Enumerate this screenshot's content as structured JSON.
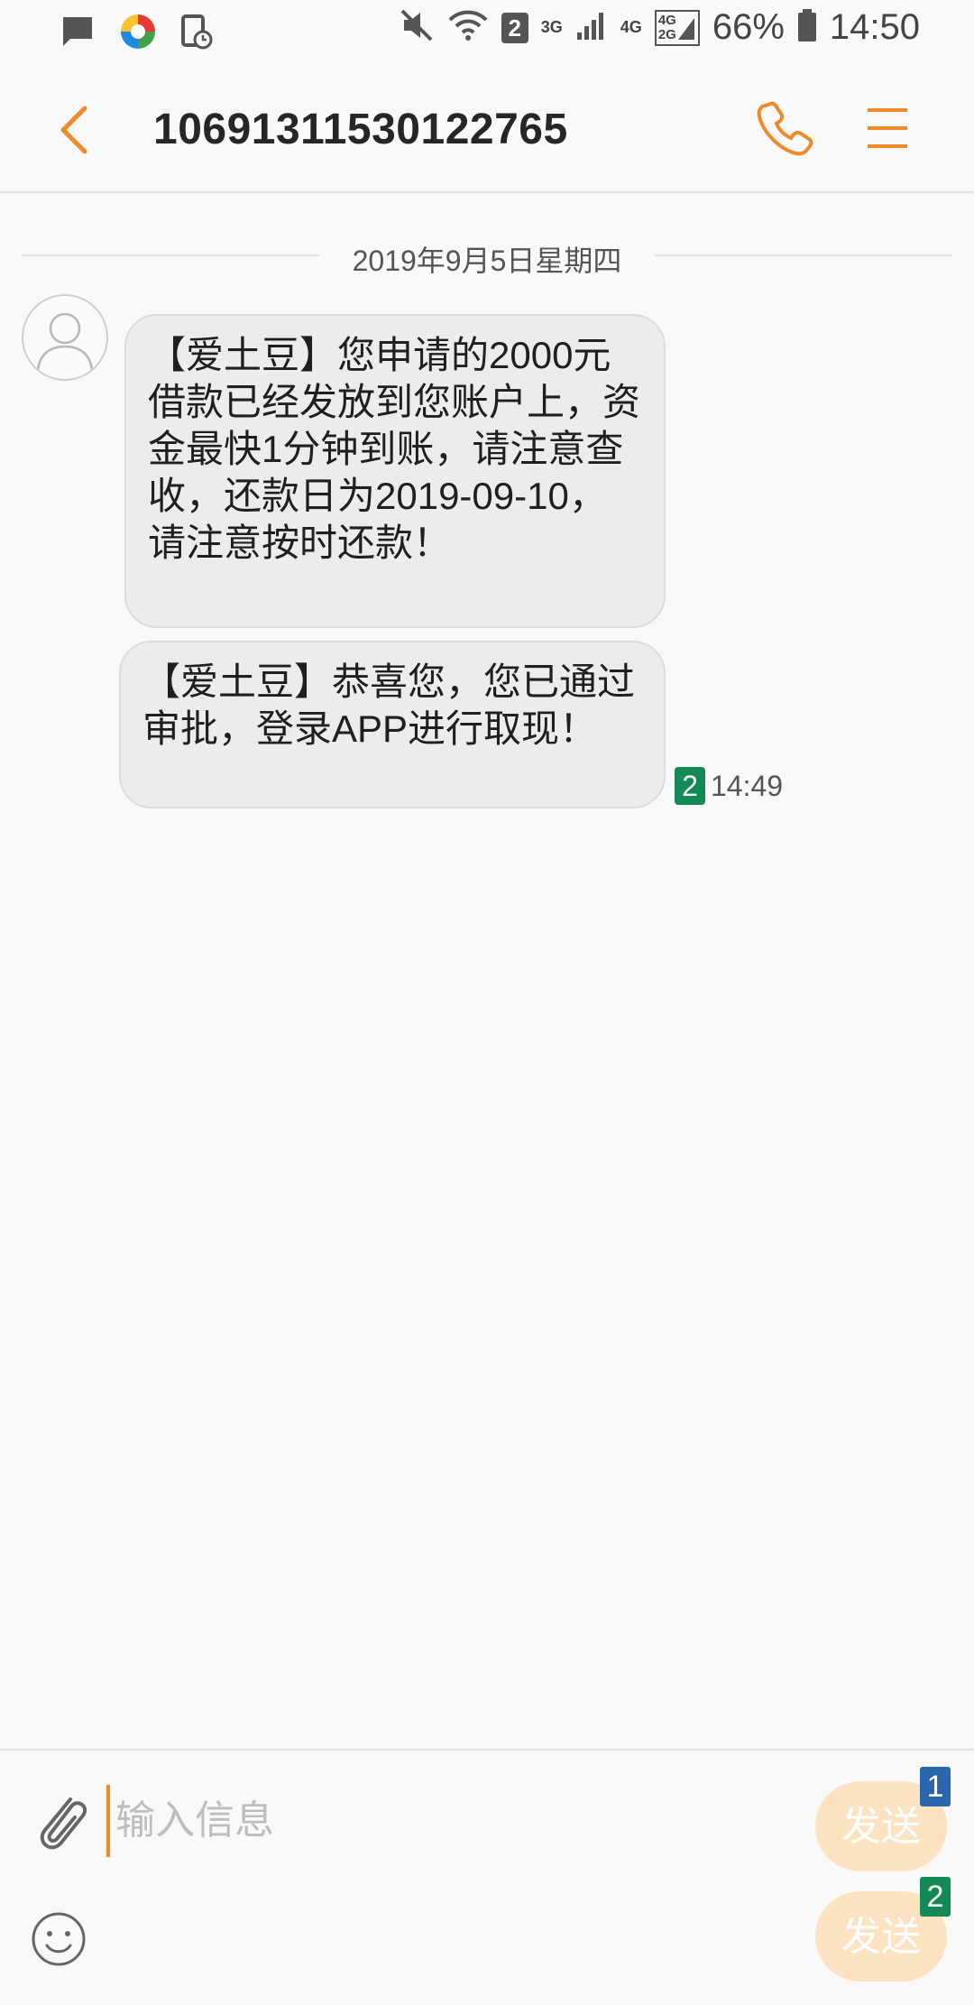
{
  "status_bar": {
    "sim_slot": "2",
    "net_3g": "3G",
    "net_4g": "4G",
    "net_4g_2": "4G",
    "net_2g": "2G",
    "battery": "66%",
    "time": "14:50"
  },
  "header": {
    "title": "10691311530122765"
  },
  "conversation": {
    "date": "2019年9月5日星期四",
    "messages": [
      {
        "text": "【爱土豆】您申请的2000元借款已经发放到您账户上，资金最快1分钟到账，请注意查收，还款日为2019-09-10，请注意按时还款！"
      },
      {
        "text": "【爱土豆】恭喜您，您已通过审批，登录APP进行取现！"
      }
    ],
    "meta": {
      "sim": "2",
      "time": "14:49"
    }
  },
  "composer": {
    "placeholder": "输入信息",
    "send1_label": "发送",
    "send2_label": "发送",
    "sim1": "1",
    "sim2": "2"
  },
  "colors": {
    "accent": "#f0892a",
    "sim1": "#2a66ad",
    "sim2": "#138a55",
    "send_disabled": "#fbe3c2"
  },
  "icons": [
    "message-icon",
    "app-icon",
    "clock-doc-icon",
    "mute-icon",
    "wifi-icon",
    "signal-icon",
    "battery-icon",
    "back-icon",
    "phone-icon",
    "menu-icon",
    "avatar-icon",
    "attach-icon",
    "emoji-icon"
  ]
}
